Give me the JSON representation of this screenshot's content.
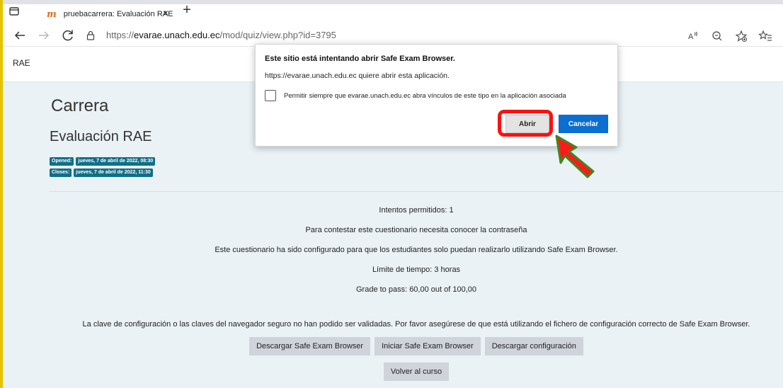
{
  "browser": {
    "tab_title": "pruebacarrera: Evaluación RAE",
    "tab_favicon": "m",
    "close_tab_glyph": "×",
    "new_tab_glyph": "+",
    "url_scheme": "https://",
    "url_host": "evarae.unach.edu.ec",
    "url_path": "/mod/quiz/view.php?id=3795",
    "icons": [
      "tab-actions-icon",
      "back-icon",
      "forward-icon",
      "reload-icon",
      "lock-icon",
      "read-aloud-icon",
      "zoom-icon",
      "add-favorite-icon",
      "favorites-icon"
    ]
  },
  "page": {
    "site_name": "RAE",
    "course_title": "Carrera",
    "quiz_title": "Evaluación RAE",
    "opened_label": "Opened:",
    "opened_value": "jueves, 7 de abril de 2022, 08:30",
    "closes_label": "Closes:",
    "closes_value": "jueves, 7 de abril de 2022, 11:30",
    "info": [
      "Intentos permitidos: 1",
      "Para contestar este cuestionario necesita conocer la contraseña",
      "Este cuestionario ha sido configurado para que los estudiantes solo puedan realizarlo utilizando Safe Exam Browser.",
      "Límite de tiempo: 3 horas",
      "Grade to pass: 60,00 out of 100,00",
      "La clave de configuración o las claves del navegador seguro no han podido ser validadas. Por favor asegúrese de que está utilizando el fichero de configuración correcto de Safe Exam Browser."
    ],
    "buttons": {
      "download_seb": "Descargar Safe Exam Browser",
      "launch_seb": "Iniciar Safe Exam Browser",
      "download_config": "Descargar configuración",
      "back_to_course": "Volver al curso"
    }
  },
  "dialog": {
    "title": "Este sitio está intentando abrir Safe Exam Browser.",
    "message": "https://evarae.unach.edu.ec quiere abrir esta aplicación.",
    "checkbox_label": "Permitir siempre que evarae.unach.edu.ec abra vínculos de este tipo en la aplicación asociada",
    "checkbox_checked": false,
    "open_label": "Abrir",
    "cancel_label": "Cancelar"
  },
  "annotation": {
    "highlight_color": "#ff1010",
    "arrow_fill": "#ff1a1a",
    "arrow_stroke": "#3b8a1e"
  }
}
